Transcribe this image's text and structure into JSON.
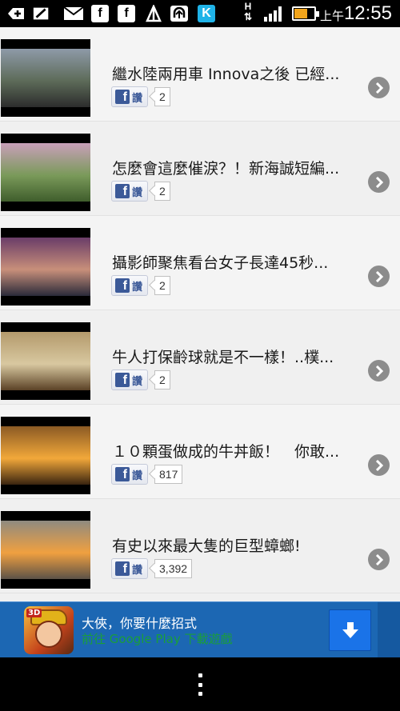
{
  "status_bar": {
    "ampm": "上午",
    "time": "12:55",
    "network_type": "H",
    "battery_level_percent": 60,
    "icons": [
      "add-box-icon",
      "edit-box-icon",
      "mail-icon",
      "facebook-icon",
      "facebook-icon",
      "antenna-icon",
      "upload-icon",
      "k-app-icon"
    ]
  },
  "articles": [
    {
      "title": "繼水陸兩用車 Innova之後 已經...",
      "fb_label": "讚",
      "like_count": "2",
      "thumb_colors": [
        "#8e9aa8",
        "#5d6b59",
        "#2c2c2c"
      ]
    },
    {
      "title": "怎麼會這麼催淚？！新海誠短編...",
      "fb_label": "讚",
      "like_count": "2",
      "thumb_colors": [
        "#c89fb9",
        "#7a9a5a",
        "#3f5d2c"
      ]
    },
    {
      "title": "攝影師聚焦看台女子長達45秒...",
      "fb_label": "讚",
      "like_count": "2",
      "thumb_colors": [
        "#6a3d68",
        "#c88f7a",
        "#2a2a3a"
      ]
    },
    {
      "title": "牛人打保齡球就是不一樣！..樸...",
      "fb_label": "讚",
      "like_count": "2",
      "thumb_colors": [
        "#b49a6c",
        "#d8c8a0",
        "#5b4226"
      ]
    },
    {
      "title": "１０顆蛋做成的牛丼飯！　你敢...",
      "fb_label": "讚",
      "like_count": "817",
      "thumb_colors": [
        "#8b5a24",
        "#f2a83a",
        "#3a2410"
      ]
    },
    {
      "title": "有史以來最大隻的巨型蟑螂!",
      "fb_label": "讚",
      "like_count": "3,392",
      "thumb_colors": [
        "#8f8a80",
        "#f0a040",
        "#5c5248"
      ]
    }
  ],
  "ad": {
    "title": "大俠，你要什麼招式",
    "subtitle": "前往 Google Play 下載遊戲",
    "badge": "3D",
    "accent": "#1c67b3"
  },
  "nav": {
    "menu_icon": "overflow-menu-icon"
  }
}
